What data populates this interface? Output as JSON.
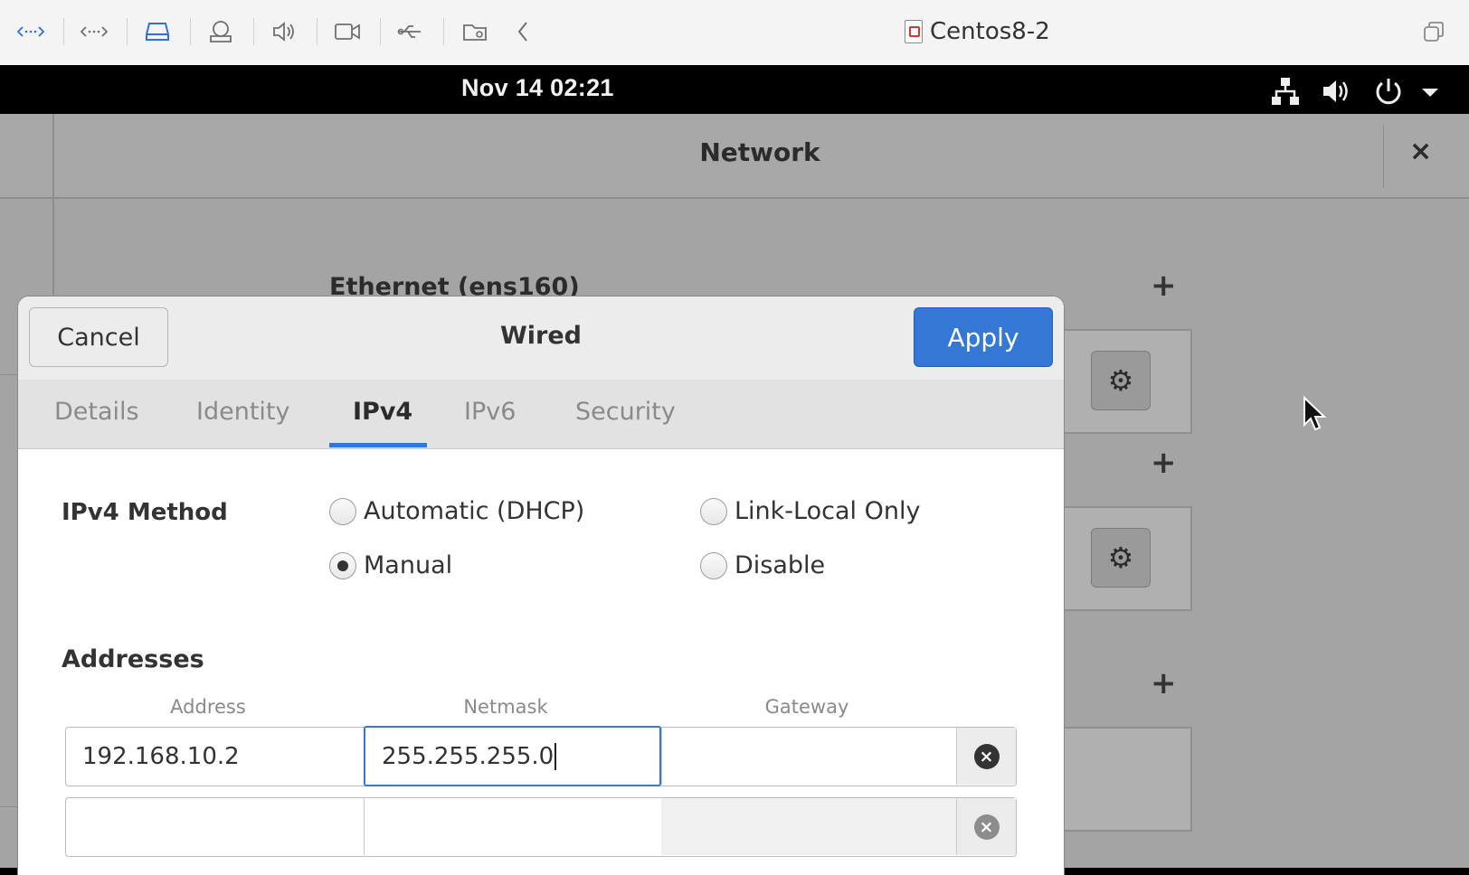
{
  "vm_toolbar": {
    "title": "Centos8-2",
    "icons": [
      "code-left-icon",
      "code-right-icon",
      "hard-disk-icon",
      "printer-icon",
      "speaker-icon",
      "camera-icon",
      "usb-icon",
      "shared-folder-icon",
      "chevron-left-icon",
      "restore-window-icon"
    ]
  },
  "top_bar": {
    "clock": "Nov 14  02:21",
    "tray_icons": [
      "network-icon",
      "volume-icon",
      "power-icon",
      "menu-arrow-icon"
    ]
  },
  "settings_window": {
    "title": "Network",
    "close_label": "×",
    "section_title": "Ethernet (ens160)",
    "add_label": "+",
    "gear_label": "⚙"
  },
  "dialog": {
    "title": "Wired",
    "cancel_label": "Cancel",
    "apply_label": "Apply",
    "tabs": [
      {
        "label": "Details",
        "active": false
      },
      {
        "label": "Identity",
        "active": false
      },
      {
        "label": "IPv4",
        "active": true
      },
      {
        "label": "IPv6",
        "active": false
      },
      {
        "label": "Security",
        "active": false
      }
    ],
    "method_label": "IPv4 Method",
    "methods": [
      {
        "label": "Automatic (DHCP)",
        "checked": false
      },
      {
        "label": "Link-Local Only",
        "checked": false
      },
      {
        "label": "Manual",
        "checked": true
      },
      {
        "label": "Disable",
        "checked": false
      }
    ],
    "addresses_label": "Addresses",
    "columns": {
      "address": "Address",
      "netmask": "Netmask",
      "gateway": "Gateway"
    },
    "rows": [
      {
        "address": "192.168.10.2",
        "netmask": "255.255.255.0",
        "gateway": ""
      },
      {
        "address": "",
        "netmask": "",
        "gateway": ""
      }
    ],
    "delete_label": "×"
  },
  "colors": {
    "accent": "#3478d4",
    "dim_background": "#a4a4a4"
  }
}
